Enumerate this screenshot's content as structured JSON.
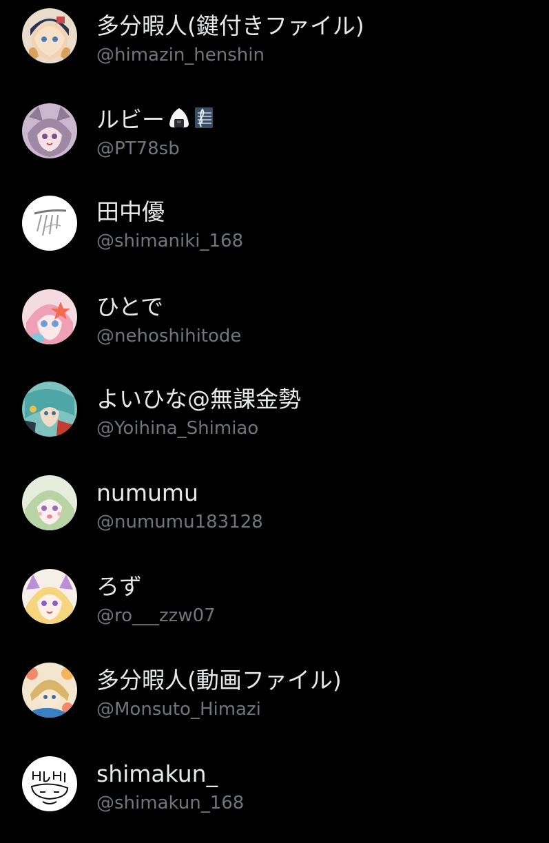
{
  "accounts": [
    {
      "name": "多分暇人(鍵付きファイル)",
      "handle": "@himazin_henshin",
      "avatar": "avatar-anime-girl-hat"
    },
    {
      "name": "ルビー",
      "name_emojis": [
        "rice-ball-icon",
        "music-score-icon"
      ],
      "handle": "@PT78sb",
      "avatar": "avatar-anime-catgirl"
    },
    {
      "name": "田中優",
      "handle": "@shimaniki_168",
      "avatar": "avatar-sketch"
    },
    {
      "name": "ひとで",
      "handle": "@nehoshihitode",
      "avatar": "avatar-anime-pink-hair"
    },
    {
      "name": "よいひな@無課金勢",
      "handle": "@Yoihina_Shimiao",
      "avatar": "avatar-anime-teal"
    },
    {
      "name": "numumu",
      "handle": "@numumu183128",
      "avatar": "avatar-anime-green-hair"
    },
    {
      "name": "ろず",
      "handle": "@ro___zzw07",
      "avatar": "avatar-anime-blonde"
    },
    {
      "name": "多分暇人(動画ファイル)",
      "handle": "@Monsuto_Himazi",
      "avatar": "avatar-anime-flowers"
    },
    {
      "name": "shimakun_",
      "handle": "@shimakun_168",
      "avatar": "avatar-doodle"
    }
  ]
}
